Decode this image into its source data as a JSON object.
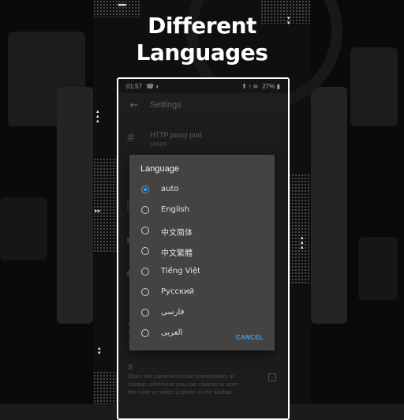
{
  "headline": {
    "line1": "Different",
    "line2": "Languages"
  },
  "status_bar": {
    "time": "01:57",
    "left_icons": "☎ ◐",
    "right_icons": "⬆ ⁞ ≋",
    "battery": "27% ▮"
  },
  "toolbar": {
    "title": "Settings",
    "back_icon": "back-arrow-icon"
  },
  "settings_behind": {
    "proxy_port": {
      "title": "HTTP proxy port",
      "value": "10809",
      "icon": "hash-icon"
    },
    "fragment_d": "D",
    "fragment_w": "W",
    "fragment_n": "n",
    "scan": {
      "title_fragment": "S",
      "line1": "Open the camera to scan immediately at",
      "line2": "startup, otherwise you can choose to scan",
      "line3": "the code or select a photo in the toolbar"
    }
  },
  "dialog": {
    "title": "Language",
    "options": [
      {
        "label": "auto",
        "checked": true
      },
      {
        "label": "English",
        "checked": false
      },
      {
        "label": "中文简体",
        "checked": false
      },
      {
        "label": "中文繁體",
        "checked": false
      },
      {
        "label": "Tiếng Việt",
        "checked": false
      },
      {
        "label": "Русский",
        "checked": false
      },
      {
        "label": "فارسی",
        "checked": false
      },
      {
        "label": "العربی",
        "checked": false
      }
    ],
    "cancel_label": "CANCEL"
  },
  "colors": {
    "accent": "#3ea0e8",
    "dialog_bg": "#434343",
    "page_bg": "#0f0f0f"
  }
}
